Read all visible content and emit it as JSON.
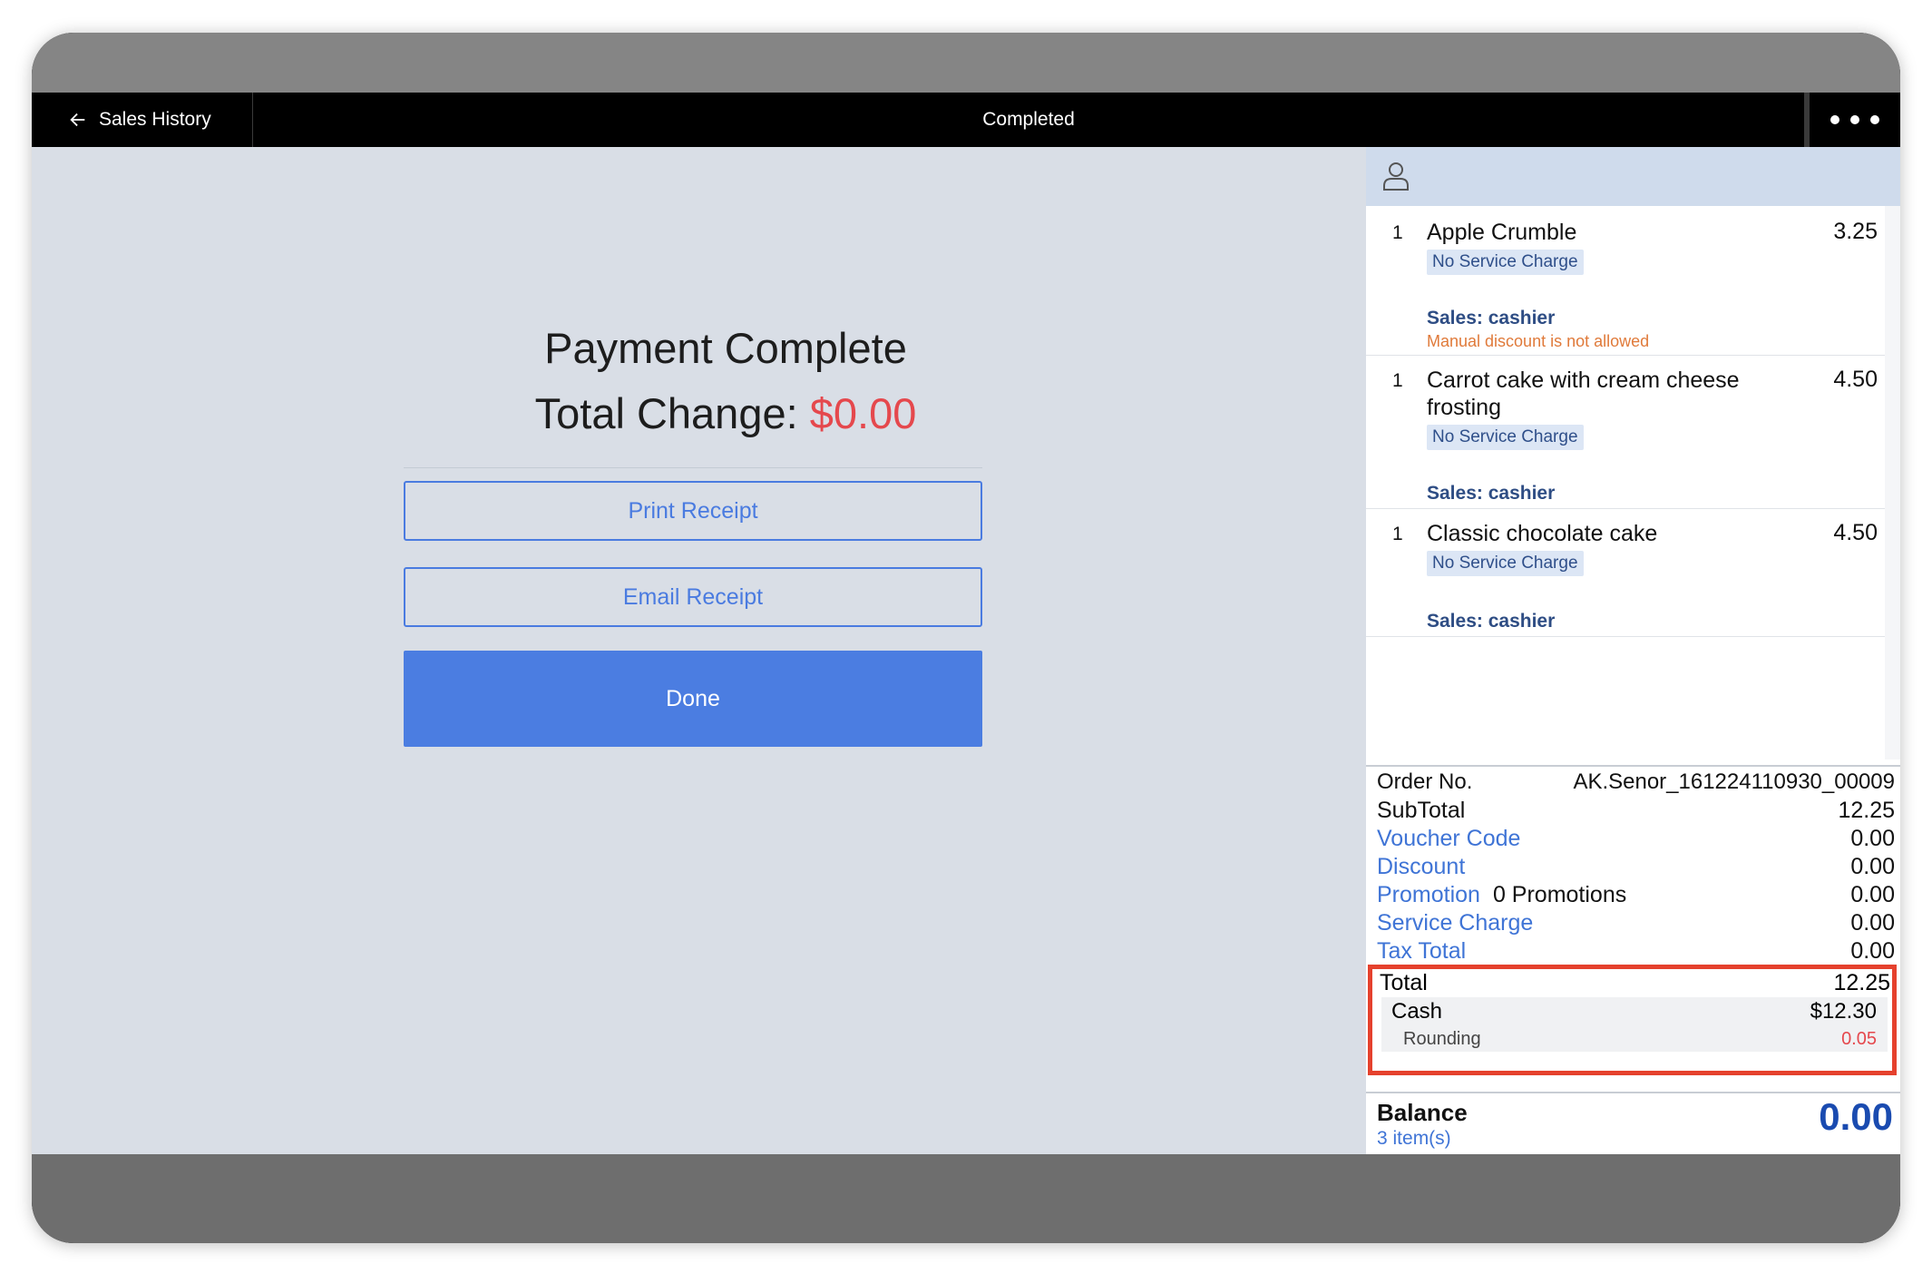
{
  "nav": {
    "back_label": "Sales History",
    "title": "Completed"
  },
  "payment": {
    "title": "Payment Complete",
    "change_label": "Total Change:",
    "change_amount": "$0.00",
    "print_label": "Print Receipt",
    "email_label": "Email Receipt",
    "done_label": "Done"
  },
  "order_items": [
    {
      "qty": "1",
      "name": "Apple Crumble",
      "price": "3.25",
      "service_charge": "No Service Charge",
      "sales": "Sales: cashier",
      "warning": "Manual discount is not allowed"
    },
    {
      "qty": "1",
      "name": "Carrot cake with cream cheese frosting",
      "price": "4.50",
      "service_charge": "No Service Charge",
      "sales": "Sales: cashier"
    },
    {
      "qty": "1",
      "name": "Classic chocolate cake",
      "price": "4.50",
      "service_charge": "No Service Charge",
      "sales": "Sales: cashier"
    }
  ],
  "summary": {
    "order_no_label": "Order No.",
    "order_no_value": "AK.Senor_161224110930_00009",
    "subtotal_label": "SubTotal",
    "subtotal_value": "12.25",
    "voucher_label": "Voucher Code",
    "voucher_value": "0.00",
    "discount_label": "Discount",
    "discount_value": "0.00",
    "promotion_label": "Promotion",
    "promotion_extra": "0 Promotions",
    "promotion_value": "0.00",
    "service_label": "Service Charge",
    "service_value": "0.00",
    "tax_label": "Tax Total",
    "tax_value": "0.00",
    "total_label": "Total",
    "total_value": "12.25",
    "cash_label": "Cash",
    "cash_value": "$12.30",
    "rounding_label": "Rounding",
    "rounding_value": "0.05",
    "balance_label": "Balance",
    "balance_value": "0.00",
    "item_count": "3 item(s)"
  },
  "colors": {
    "accent": "#4b7de1",
    "change_red": "#e5484d",
    "highlight_box": "#e5412d",
    "link_blue": "#3f74d6",
    "balance_blue": "#1a4bb0"
  },
  "icons": {
    "back": "arrow-left-icon",
    "more": "more-horizontal-icon",
    "customer": "user-icon"
  }
}
